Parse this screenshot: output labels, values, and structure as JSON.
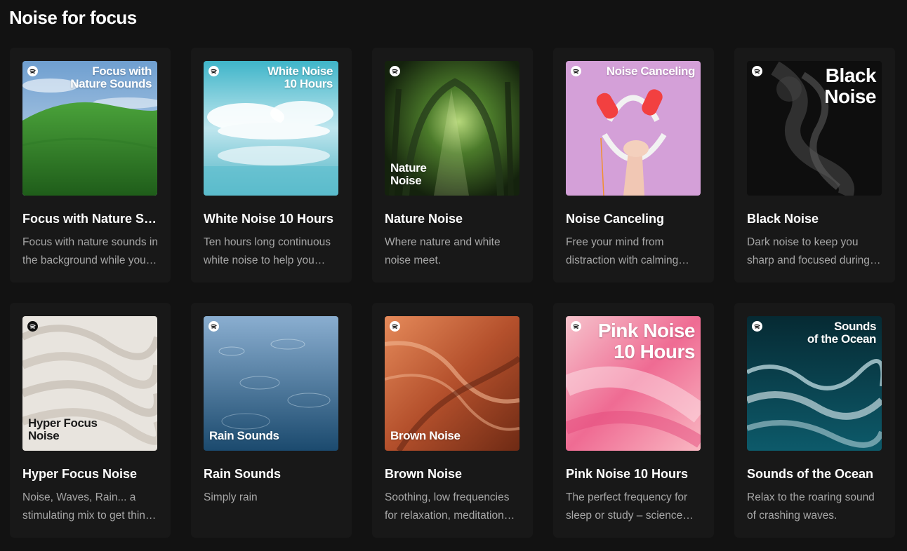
{
  "section": {
    "title": "Noise for focus"
  },
  "cards": [
    {
      "cover_text": "Focus with\nNature Sounds",
      "title": "Focus with Nature Sounds",
      "description": "Focus with nature sounds in the background while you study or work."
    },
    {
      "cover_text": "White Noise\n10 Hours",
      "title": "White Noise 10 Hours",
      "description": "Ten hours long continuous white noise to help you relax."
    },
    {
      "cover_text": "Nature\nNoise",
      "title": "Nature Noise",
      "description": "Where nature and white noise meet."
    },
    {
      "cover_text": "Noise Canceling",
      "title": "Noise Canceling",
      "description": "Free your mind from distraction with calming noise."
    },
    {
      "cover_text": "Black\nNoise",
      "title": "Black Noise",
      "description": "Dark noise to keep you sharp and focused during work."
    },
    {
      "cover_text": "Hyper Focus\nNoise",
      "title": "Hyper Focus Noise",
      "description": "Noise, Waves, Rain... a stimulating mix to get things done."
    },
    {
      "cover_text": "Rain Sounds",
      "title": "Rain Sounds",
      "description": "Simply rain"
    },
    {
      "cover_text": "Brown Noise",
      "title": "Brown Noise",
      "description": "Soothing, low frequencies for relaxation, meditation and sleep."
    },
    {
      "cover_text": "Pink Noise\n10 Hours",
      "title": "Pink Noise 10 Hours",
      "description": "The perfect frequency for sleep or study – science says so."
    },
    {
      "cover_text": "Sounds\nof the Ocean",
      "title": "Sounds of the Ocean",
      "description": "Relax to the roaring sound of crashing waves."
    }
  ],
  "colors": {
    "background": "#121212",
    "card": "#181818",
    "subtext": "#a7a7a7"
  },
  "icons": {
    "cover_logo": "spotify-logo-icon"
  }
}
